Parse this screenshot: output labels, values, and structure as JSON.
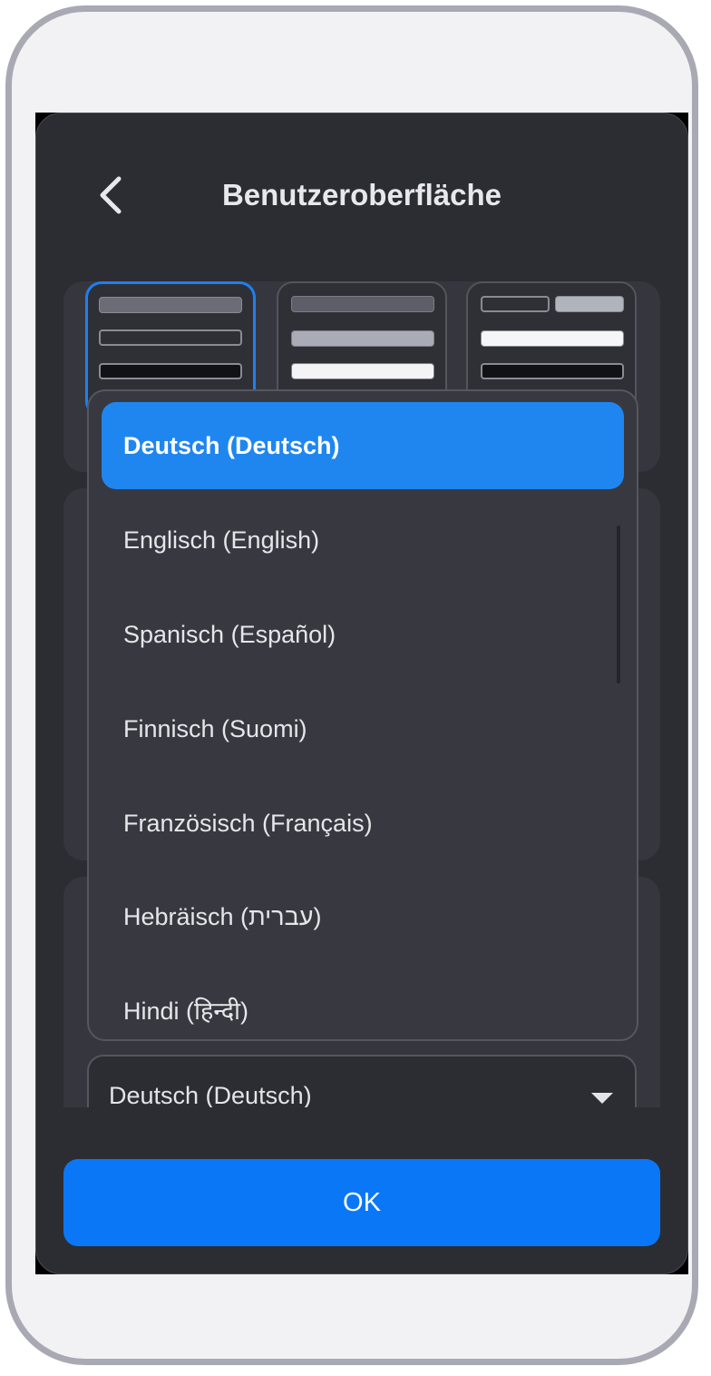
{
  "header": {
    "title": "Benutzeroberfläche",
    "back_icon": "chevron-left-icon"
  },
  "theme_options": [
    {
      "name": "dark-theme",
      "selected": true
    },
    {
      "name": "gray-theme",
      "selected": false
    },
    {
      "name": "light-theme",
      "selected": false
    }
  ],
  "language": {
    "selected": "Deutsch (Deutsch)",
    "dropdown_icon": "caret-down-icon",
    "options": [
      {
        "label": "Deutsch (Deutsch)",
        "active": true
      },
      {
        "label": "Englisch (English)",
        "active": false
      },
      {
        "label": "Spanisch (Español)",
        "active": false
      },
      {
        "label": "Finnisch (Suomi)",
        "active": false
      },
      {
        "label": "Französisch (Français)",
        "active": false
      },
      {
        "label": "Hebräisch (עברית)",
        "active": false
      },
      {
        "label": "Hindi (हिन्दी)",
        "active": false
      }
    ]
  },
  "footer": {
    "ok_label": "OK"
  },
  "colors": {
    "accent": "#0a78f6",
    "dialog_bg": "#2c2d33",
    "active_option": "#1f86f0"
  }
}
